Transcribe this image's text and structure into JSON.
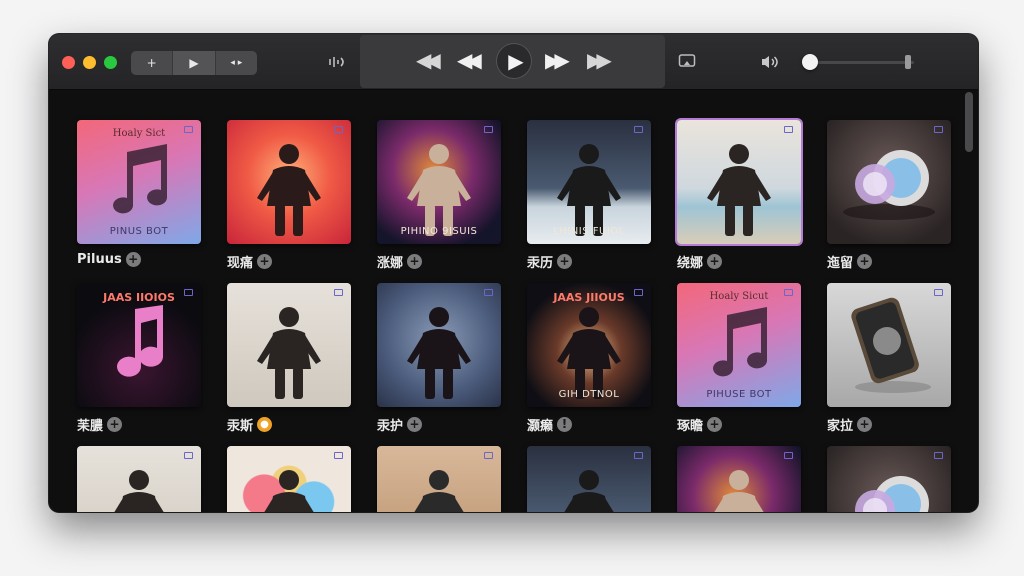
{
  "toolbar": {
    "add_label": "+",
    "play_label": "▶",
    "more_label": "◂ ▸",
    "rewind_label": "◀◀",
    "prev_label": "◀◀",
    "next_label": "▶▶",
    "forward_label": "▶▶",
    "center_play_label": "▶",
    "volume_level": 0.05,
    "icons": [
      "add-icon",
      "play-icon",
      "more-icon",
      "equalizer-icon",
      "rewind-icon",
      "previous-icon",
      "play-icon",
      "next-icon",
      "fast-forward-icon",
      "airplay-icon",
      "volume-icon"
    ]
  },
  "albums": [
    {
      "caption": "Piluus",
      "cover_top": "Hoaly Sict",
      "cover_bottom": "PINUS BOT",
      "action": "+",
      "style": "note-pink"
    },
    {
      "caption": "现痛",
      "cover_top": "",
      "cover_bottom": "",
      "action": "+",
      "style": "red-burst"
    },
    {
      "caption": "涨娜",
      "cover_top": "",
      "cover_bottom": "PIHINO 9ISUIS",
      "action": "+",
      "style": "cosmic"
    },
    {
      "caption": "汞历",
      "cover_top": "",
      "cover_bottom": "LHINIS FUIOL",
      "action": "+",
      "style": "beach-dark"
    },
    {
      "caption": "绕娜",
      "cover_top": "",
      "cover_bottom": "",
      "action": "+",
      "style": "beach-light"
    },
    {
      "caption": "迤留",
      "cover_top": "",
      "cover_bottom": "",
      "action": "+",
      "style": "speaker"
    },
    {
      "caption": "苿膿",
      "cover_top": "JAAS IIOIOS",
      "cover_bottom": "",
      "action": "+",
      "style": "note-dark"
    },
    {
      "caption": "汞斯",
      "cover_top": "",
      "cover_bottom": "",
      "action": "●",
      "style": "studio-light"
    },
    {
      "caption": "汞护",
      "cover_top": "",
      "cover_bottom": "",
      "action": "+",
      "style": "blue-stage"
    },
    {
      "caption": "灏癞",
      "cover_top": "JAAS JIIOUS",
      "cover_bottom": "GIH DTNOL",
      "action": "!",
      "style": "dark-burst"
    },
    {
      "caption": "琢瞻",
      "cover_top": "Hoaly Sicut",
      "cover_bottom": "PIHUSE BOT",
      "action": "+",
      "style": "note-pink"
    },
    {
      "caption": "家拉",
      "cover_top": "",
      "cover_bottom": "",
      "action": "+",
      "style": "device"
    },
    {
      "caption": "",
      "cover_top": "",
      "cover_bottom": "",
      "action": "",
      "style": "studio-light"
    },
    {
      "caption": "",
      "cover_top": "",
      "cover_bottom": "",
      "action": "",
      "style": "circles"
    },
    {
      "caption": "",
      "cover_top": "",
      "cover_bottom": "",
      "action": "",
      "style": "desert"
    },
    {
      "caption": "",
      "cover_top": "",
      "cover_bottom": "",
      "action": "",
      "style": "beach-dark"
    },
    {
      "caption": "",
      "cover_top": "",
      "cover_bottom": "",
      "action": "",
      "style": "cosmic"
    },
    {
      "caption": "",
      "cover_top": "",
      "cover_bottom": "",
      "action": "",
      "style": "speaker"
    }
  ],
  "colors": {
    "accent_selection": "#b57bd6",
    "window_bg": "#0f0f10",
    "toolbar_bg": "#2e2e30"
  }
}
